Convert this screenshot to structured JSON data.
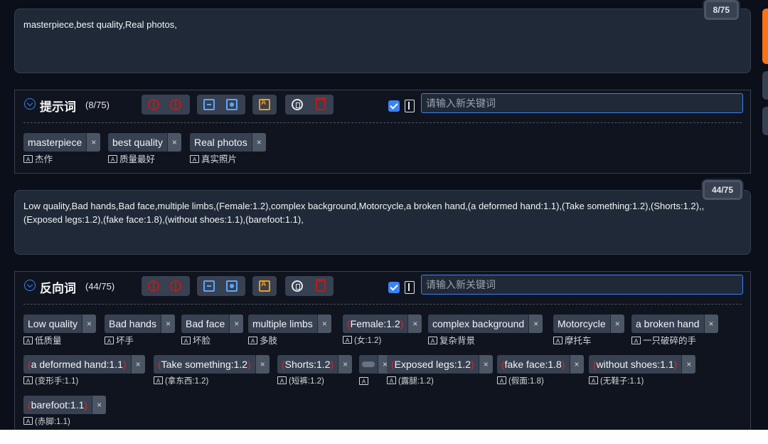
{
  "positive": {
    "prompt_text": "masterpiece,best quality,Real photos,",
    "counter": "8/75",
    "title": "提示词",
    "count": "(8/75)",
    "input_placeholder": "请输入新关键词",
    "tags": [
      {
        "label": "masterpiece",
        "translation": "杰作"
      },
      {
        "label": "best quality",
        "translation": "质量最好"
      },
      {
        "label": "Real photos",
        "translation": "真实照片"
      }
    ]
  },
  "negative": {
    "prompt_text": "Low quality,Bad hands,Bad face,multiple limbs,(Female:1.2),complex background,Motorcycle,a broken hand,(a deformed hand:1.1),(Take something:1.2),(Shorts:1.2),,(Exposed legs:1.2),(fake face:1.8),(without shoes:1.1),(barefoot:1.1),",
    "counter": "44/75",
    "title": "反向词",
    "count": "(44/75)",
    "input_placeholder": "请输入新关键词",
    "tags": [
      {
        "label": "Low quality",
        "translation": "低质量",
        "weighted": false
      },
      {
        "label": "Bad hands",
        "translation": "坏手",
        "weighted": false
      },
      {
        "label": "Bad face",
        "translation": "坏脸",
        "weighted": false
      },
      {
        "label": "multiple limbs",
        "translation": "多肢",
        "weighted": false
      },
      {
        "label": "Female:1.2",
        "translation": "(女:1.2)",
        "weighted": true
      },
      {
        "label": "complex background",
        "translation": "复杂背景",
        "weighted": false
      },
      {
        "label": "Motorcycle",
        "translation": "摩托车",
        "weighted": false
      },
      {
        "label": "a broken hand",
        "translation": "一只破碎的手",
        "weighted": false
      },
      {
        "label": "a deformed hand:1.1",
        "translation": "(变形手:1.1)",
        "weighted": true
      },
      {
        "label": "Take something:1.2",
        "translation": "(拿东西:1.2)",
        "weighted": true
      },
      {
        "label": "Shorts:1.2",
        "translation": "(短裤:1.2)",
        "weighted": true
      },
      {
        "label": "",
        "translation": "",
        "weighted": false,
        "blank": true
      },
      {
        "label": "Exposed legs:1.2",
        "translation": "(露腿:1.2)",
        "weighted": true
      },
      {
        "label": "fake face:1.8",
        "translation": "(假面:1.8)",
        "weighted": true
      },
      {
        "label": "without shoes:1.1",
        "translation": "(无鞋子:1.1)",
        "weighted": true
      },
      {
        "label": "barefoot:1.1",
        "translation": "(赤脚:1.1)",
        "weighted": true
      }
    ]
  },
  "icons": {
    "close": "×",
    "translate": "A"
  }
}
